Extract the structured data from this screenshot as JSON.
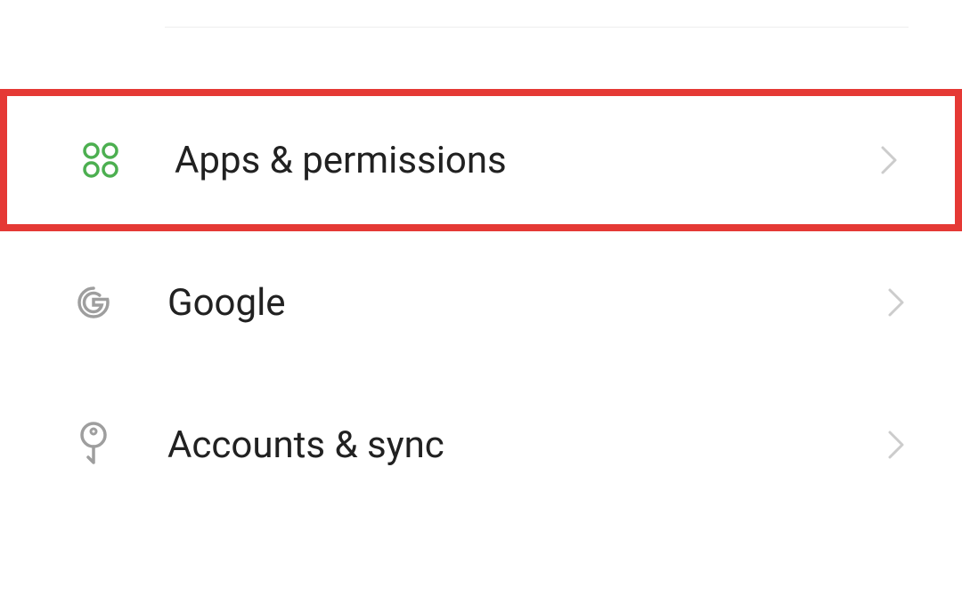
{
  "settings": {
    "items": [
      {
        "label": "Apps & permissions",
        "icon": "apps-icon",
        "highlighted": true
      },
      {
        "label": "Google",
        "icon": "google-icon",
        "highlighted": false
      },
      {
        "label": "Accounts & sync",
        "icon": "key-icon",
        "highlighted": false
      }
    ]
  },
  "colors": {
    "highlight": "#e53935",
    "apps_icon": "#4caf50",
    "default_icon": "#9e9e9e",
    "chevron": "#cccccc",
    "text": "#212121"
  }
}
